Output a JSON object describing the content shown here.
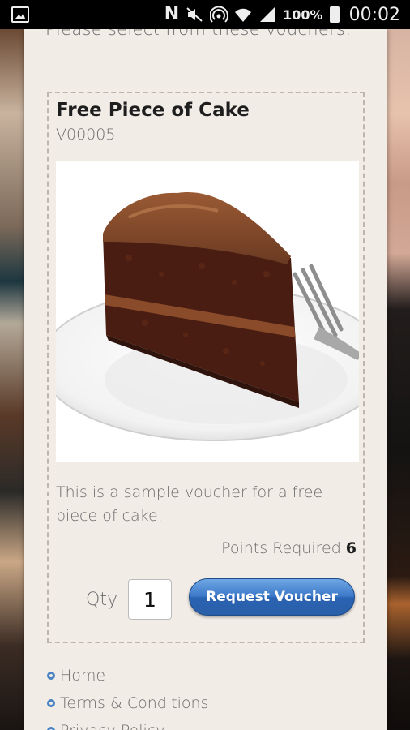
{
  "status_bar": {
    "battery_percent": "100%",
    "time": "00:02",
    "icons": [
      "gallery-icon",
      "nfc-icon",
      "mute-icon",
      "hotspot-icon",
      "wifi-icon",
      "signal-icon",
      "battery-icon"
    ]
  },
  "intro_text": "Please select from these vouchers:",
  "voucher": {
    "title": "Free Piece of Cake",
    "code": "V00005",
    "image": "chocolate-cake-slice",
    "description": "This is a sample voucher for a free piece of cake.",
    "points_label": "Points Required",
    "points_value": "6",
    "qty_label": "Qty",
    "qty_value": "1",
    "request_button": "Request Voucher"
  },
  "footer_nav": [
    {
      "label": "Home"
    },
    {
      "label": "Terms & Conditions"
    },
    {
      "label": "Privacy Policy"
    }
  ],
  "colors": {
    "panel_bg": "#f1ece6",
    "button_blue": "#2a63b3",
    "bullet_blue": "#4a82c4"
  }
}
